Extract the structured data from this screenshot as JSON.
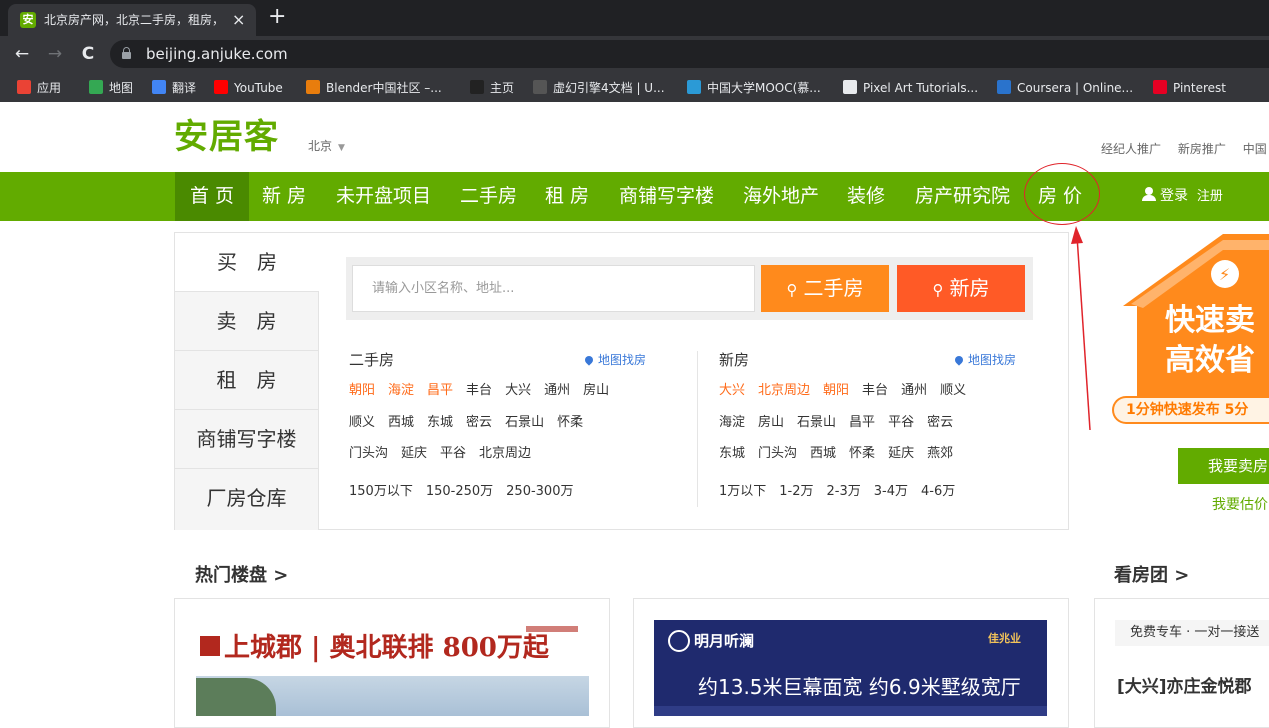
{
  "browser": {
    "tab_title": "北京房产网，北京二手房，租房，",
    "tab_favicon_text": "安",
    "tab_close": "×",
    "new_tab": "+",
    "back": "←",
    "forward": "→",
    "reload": "C",
    "url": "beijing.anjuke.com",
    "bookmarks": [
      {
        "label": "应用",
        "icon": "apps-grid-icon",
        "color": "#ea4335"
      },
      {
        "label": "地图",
        "icon": "google-maps-icon",
        "color": "#34a853"
      },
      {
        "label": "翻译",
        "icon": "google-translate-icon",
        "color": "#4285f4"
      },
      {
        "label": "YouTube",
        "icon": "youtube-icon",
        "color": "#ff0000"
      },
      {
        "label": "Blender中国社区 –...",
        "icon": "blender-icon",
        "color": "#e87d0d"
      },
      {
        "label": "主页",
        "icon": "unity-icon",
        "color": "#222222"
      },
      {
        "label": "虚幻引擎4文档 | U...",
        "icon": "unreal-icon",
        "color": "#555555"
      },
      {
        "label": "中国大学MOOC(慕...",
        "icon": "mooc-icon",
        "color": "#2b9ad6"
      },
      {
        "label": "Pixel Art Tutorials...",
        "icon": "pixel-art-icon",
        "color": "#e8eaed"
      },
      {
        "label": "Coursera | Online...",
        "icon": "coursera-icon",
        "color": "#2a73cc"
      },
      {
        "label": "Pinterest",
        "icon": "pinterest-icon",
        "color": "#e60023"
      }
    ]
  },
  "site": {
    "logo": "安居客",
    "city": "北京",
    "city_caret": "▼",
    "top_links": [
      "经纪人推广",
      "新房推广",
      "中国"
    ],
    "nav": [
      "首 页",
      "新 房",
      "未开盘项目",
      "二手房",
      "租 房",
      "商铺写字楼",
      "海外地产",
      "装修",
      "房产研究院",
      "房 价"
    ],
    "login": "登录",
    "register": "注册",
    "accent": "#62ab00"
  },
  "search": {
    "side_tabs": [
      "买　房",
      "卖　房",
      "租　房",
      "商铺写字楼",
      "厂房仓库"
    ],
    "placeholder": "请输入小区名称、地址...",
    "btn_second": "二手房",
    "btn_new": "新房",
    "btn_second_color": "#ff8a1c",
    "btn_new_color": "#ff5a26"
  },
  "second_hand": {
    "title": "二手房",
    "map_link": "地图找房",
    "rows": [
      [
        "朝阳",
        "海淀",
        "昌平",
        "丰台",
        "大兴",
        "通州",
        "房山"
      ],
      [
        "顺义",
        "西城",
        "东城",
        "密云",
        "石景山",
        "怀柔"
      ],
      [
        "门头沟",
        "延庆",
        "平谷",
        "北京周边"
      ],
      [
        "150万以下",
        "150-250万",
        "250-300万"
      ]
    ],
    "highlight_count": 3
  },
  "new_house": {
    "title": "新房",
    "map_link": "地图找房",
    "rows": [
      [
        "大兴",
        "北京周边",
        "朝阳",
        "丰台",
        "通州",
        "顺义"
      ],
      [
        "海淀",
        "房山",
        "石景山",
        "昌平",
        "平谷",
        "密云"
      ],
      [
        "东城",
        "门头沟",
        "西城",
        "怀柔",
        "延庆",
        "燕郊"
      ],
      [
        "1万以下",
        "1-2万",
        "2-3万",
        "3-4万",
        "4-6万"
      ]
    ],
    "highlight_count": 3
  },
  "promo": {
    "line1": "快速卖",
    "line2": "高效省",
    "banner": "1分钟快速发布 5分",
    "sell_button": "我要卖房",
    "estimate_link": "我要估价"
  },
  "hot": {
    "title": "热门楼盘 >",
    "ad1_text": "上城郡 | 奥北联排 800万起",
    "ad2_brand": "明月听澜",
    "ad2_right": "佳兆业",
    "ad2_main": "约13.5米巨幕面宽  约6.9米墅级宽厅"
  },
  "tour": {
    "title": "看房团 >",
    "tags": "免费专车 · 一对一接送",
    "name": "[大兴]亦庄金悦郡"
  }
}
